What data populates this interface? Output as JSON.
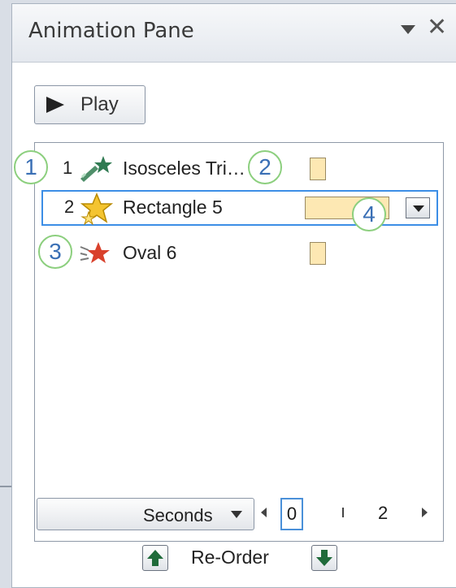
{
  "pane": {
    "title": "Animation Pane",
    "dropdown_icon": "chevron-down-icon",
    "close_icon": "close-icon"
  },
  "toolbar": {
    "play_label": "Play",
    "play_icon": "play-icon"
  },
  "animations": [
    {
      "number": "1",
      "label": "Isosceles Tri…",
      "effect_icon": "entrance-effect-icon",
      "selected": false
    },
    {
      "number": "2",
      "label": "Rectangle 5",
      "effect_icon": "emphasis-effect-icon",
      "selected": true
    },
    {
      "number": "",
      "label": "Oval 6",
      "effect_icon": "exit-effect-icon",
      "selected": false
    }
  ],
  "callouts": [
    "1",
    "2",
    "3",
    "4"
  ],
  "timeline": {
    "units_label": "Seconds",
    "tick_zero": "0",
    "tick_two": "2"
  },
  "reorder": {
    "label": "Re-Order",
    "up_icon": "arrow-up-icon",
    "down_icon": "arrow-down-icon"
  },
  "colors": {
    "selection_border": "#3c8ee6",
    "timing_bar": "#fde8b3",
    "callout_ring": "#8ccf7e",
    "callout_text": "#3a6fb5"
  }
}
